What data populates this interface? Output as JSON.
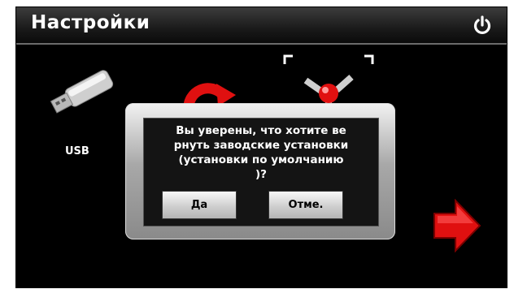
{
  "header": {
    "title": "Настройки",
    "power_icon": "power-icon"
  },
  "items": {
    "usb_label": "USB",
    "usb_icon": "usb-drive-icon",
    "refresh_icon": "refresh-icon",
    "satellite_icon": "satellite-icon",
    "next_icon": "arrow-right-icon"
  },
  "dialog": {
    "message": "Вы уверены, что хотите ве\nрнуть заводские установки\n(установки по умолчанию\n)?",
    "yes_label": "Да",
    "cancel_label": "Отме."
  },
  "colors": {
    "background": "#000000",
    "accent_red": "#e01010",
    "dialog_gray": "#a8a8a8"
  }
}
